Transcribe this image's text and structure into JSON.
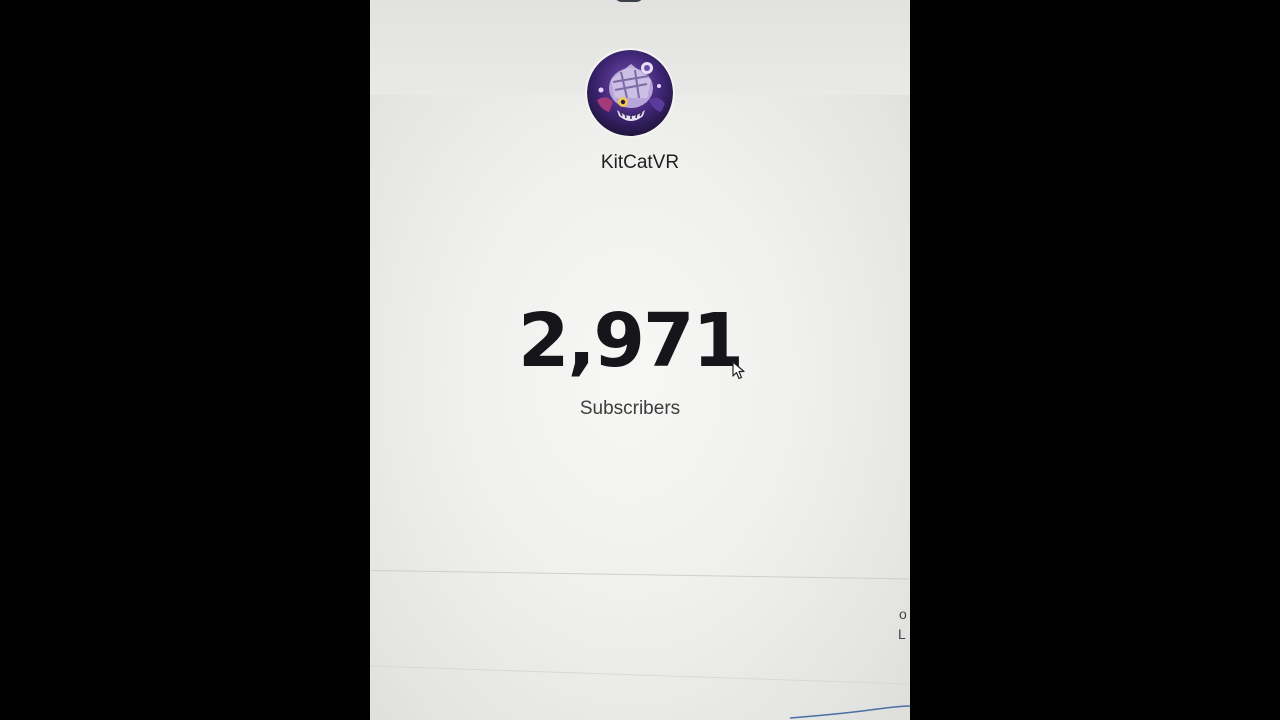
{
  "channel": {
    "name": "KitCatVR",
    "avatar_icon": "channel-avatar-icon"
  },
  "stats": {
    "subscriber_count": "2,971",
    "subscriber_label": "Subscribers"
  },
  "cropped_edge_text": [
    "o",
    "L"
  ],
  "colors": {
    "count_text": "#15151a",
    "page_background": "#efefed",
    "letterbox": "#000000"
  }
}
